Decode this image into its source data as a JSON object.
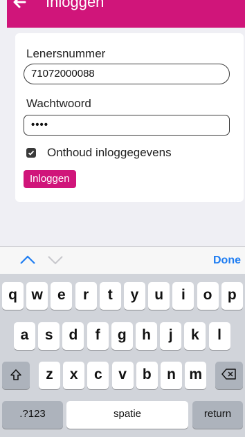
{
  "header": {
    "title": "Inloggen",
    "back_icon": "arrow-left-icon",
    "color": "#d0157a"
  },
  "form": {
    "username_label": "Lenersnummer",
    "username_value": "71072000088",
    "password_label": "Wachtwoord",
    "password_value": "••••",
    "remember_label": "Onthoud inloggegevens",
    "remember_checked": true,
    "login_button": "Inloggen"
  },
  "toolbar": {
    "prev_icon": "chevron-up-icon",
    "next_icon": "chevron-down-icon",
    "done_label": "Done",
    "accent": "#1d7cf2"
  },
  "keyboard": {
    "row1": [
      "q",
      "w",
      "e",
      "r",
      "t",
      "y",
      "u",
      "i",
      "o",
      "p"
    ],
    "row2": [
      "a",
      "s",
      "d",
      "f",
      "g",
      "h",
      "j",
      "k",
      "l"
    ],
    "row3": [
      "z",
      "x",
      "c",
      "v",
      "b",
      "n",
      "m"
    ],
    "shift_icon": "shift-icon",
    "delete_icon": "delete-icon",
    "numbers_label": ".?123",
    "space_label": "spatie",
    "return_label": "return"
  }
}
